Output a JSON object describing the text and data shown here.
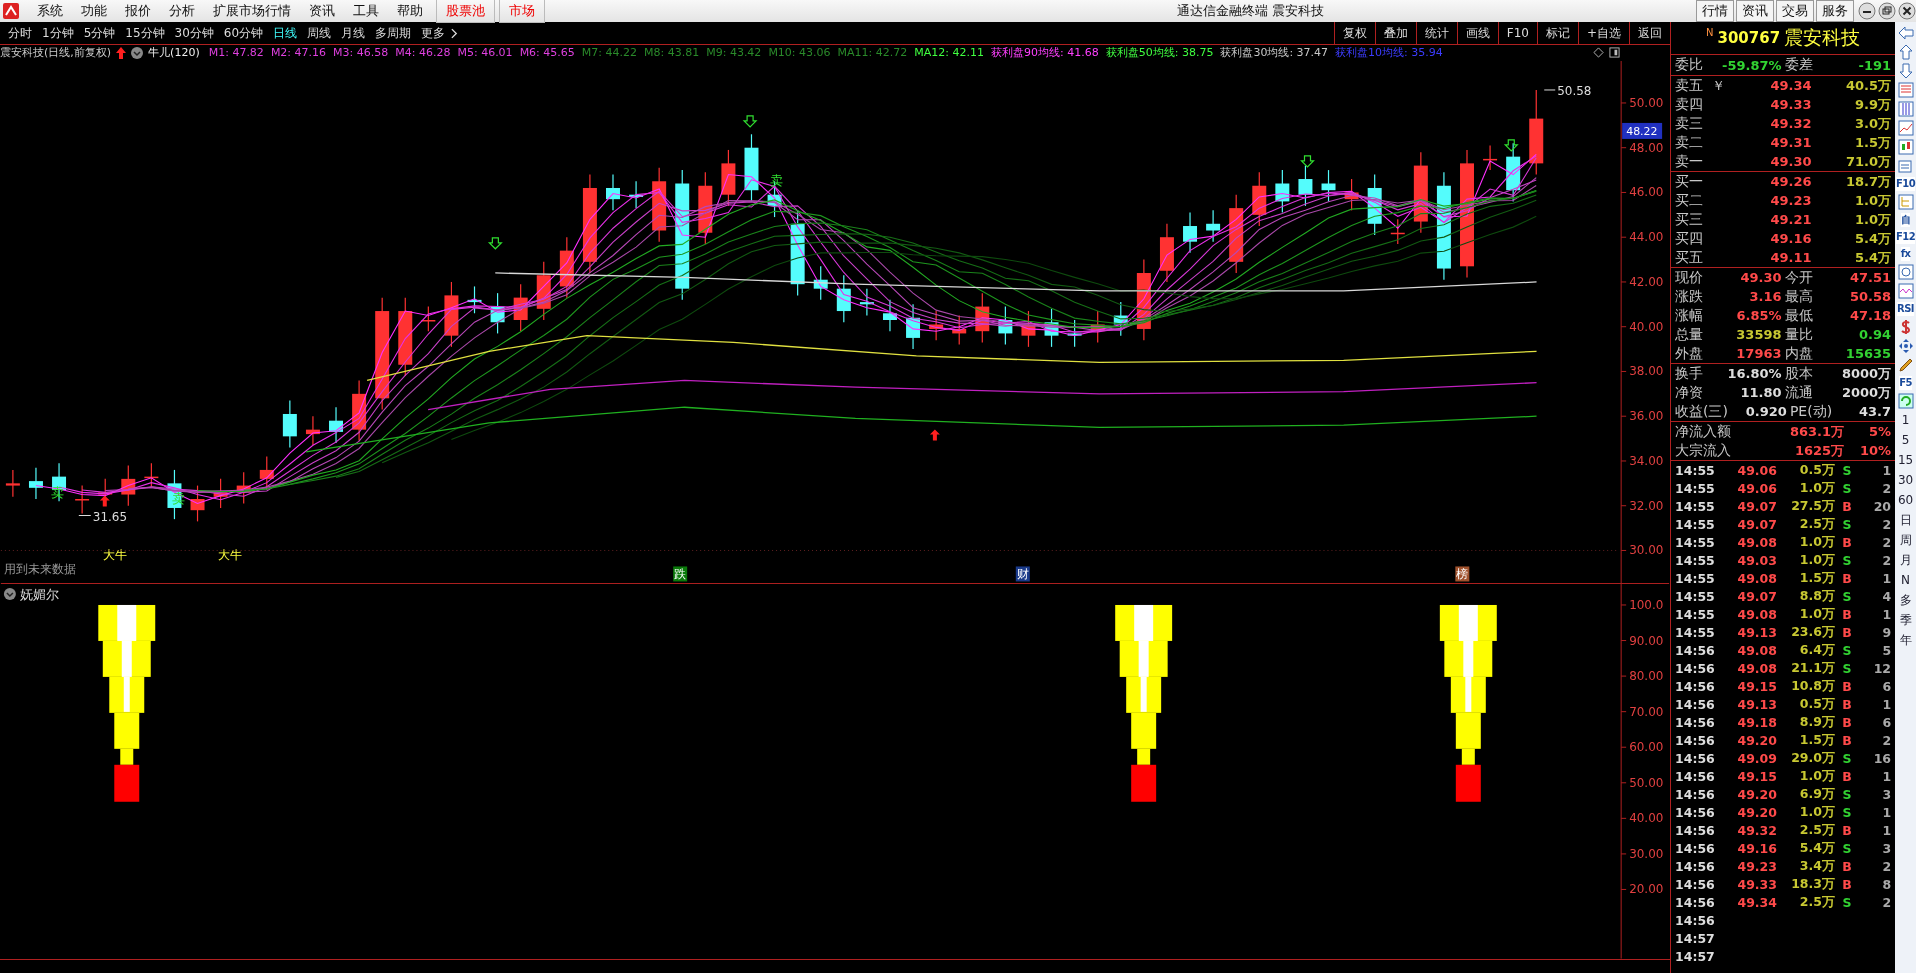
{
  "menu_bar": {
    "items": [
      {
        "label": "系统",
        "kind": "plain"
      },
      {
        "label": "功能",
        "kind": "plain"
      },
      {
        "label": "报价",
        "kind": "plain"
      },
      {
        "label": "分析",
        "kind": "plain"
      },
      {
        "label": "扩展市场行情",
        "kind": "plain"
      },
      {
        "label": "资讯",
        "kind": "plain"
      },
      {
        "label": "工具",
        "kind": "plain"
      },
      {
        "label": "帮助",
        "kind": "plain"
      },
      {
        "label": "股票池",
        "kind": "highlight"
      },
      {
        "label": "市场",
        "kind": "highlight"
      }
    ],
    "title": "通达信金融终端 震安科技",
    "buttons": [
      "行情",
      "资讯",
      "交易",
      "服务"
    ]
  },
  "period_tabs": [
    {
      "label": "分时",
      "selected": false
    },
    {
      "label": "1分钟",
      "selected": false
    },
    {
      "label": "5分钟",
      "selected": false
    },
    {
      "label": "15分钟",
      "selected": false
    },
    {
      "label": "30分钟",
      "selected": false
    },
    {
      "label": "60分钟",
      "selected": false
    },
    {
      "label": "日线",
      "selected": true
    },
    {
      "label": "周线",
      "selected": false
    },
    {
      "label": "月线",
      "selected": false
    },
    {
      "label": "多周期",
      "selected": false
    },
    {
      "label": "更多",
      "selected": false
    }
  ],
  "toolbar": [
    "复权",
    "叠加",
    "统计",
    "画线",
    "F10",
    "标记",
    "+自选",
    "返回"
  ],
  "indicator_header": {
    "stock": "震安科技(日线,前复权)",
    "formula": "牛儿(120)",
    "values": [
      {
        "text": "M1: 47.82",
        "color": "#e040e0"
      },
      {
        "text": "M2: 47.16",
        "color": "#e040e0"
      },
      {
        "text": "M3: 46.58",
        "color": "#e040e0"
      },
      {
        "text": "M4: 46.28",
        "color": "#e040e0"
      },
      {
        "text": "M5: 46.01",
        "color": "#e040e0"
      },
      {
        "text": "M6: 45.65",
        "color": "#e040e0"
      },
      {
        "text": "M7: 44.22",
        "color": "#2a8a2a"
      },
      {
        "text": "M8: 43.81",
        "color": "#2a8a2a"
      },
      {
        "text": "M9: 43.42",
        "color": "#2a8a2a"
      },
      {
        "text": "M10: 43.06",
        "color": "#2a8a2a"
      },
      {
        "text": "MA11: 42.72",
        "color": "#2a8a2a"
      },
      {
        "text": "MA12: 42.11",
        "color": "#40ff40"
      },
      {
        "text": "获利盘90均线: 41.68",
        "color": "#ff40ff"
      },
      {
        "text": "获利盘50均线: 38.75",
        "color": "#40ff40"
      },
      {
        "text": "获利盘30均线: 37.47",
        "color": "#c8c8c8"
      },
      {
        "text": "获利盘10均线: 35.94",
        "color": "#3c3cff"
      }
    ]
  },
  "main_chart": {
    "y_ticks": [
      "50.00",
      "48.00",
      "46.00",
      "44.00",
      "42.00",
      "40.00",
      "38.00",
      "36.00",
      "34.00",
      "32.00",
      "30.00"
    ],
    "last_price_tag": "48.22",
    "high_label": "50.58",
    "low_label": "31.65",
    "warning": "用到未来数据",
    "sell_marks": [
      "卖",
      "卖",
      "卖"
    ],
    "bull_marks": [
      "大牛",
      "大牛"
    ],
    "tags": [
      {
        "text": "跌",
        "color": "#0a7a0a"
      },
      {
        "text": "财",
        "color": "#1a3a8a"
      },
      {
        "text": "榜",
        "color": "#a0522d"
      }
    ]
  },
  "sub_chart": {
    "title": "妩媚尔",
    "y_ticks": [
      "100.0",
      "90.00",
      "80.00",
      "70.00",
      "60.00",
      "50.00",
      "40.00",
      "30.00",
      "20.00"
    ]
  },
  "quote_panel": {
    "badge": "N",
    "code": "300767",
    "name": "震安科技",
    "ratio": [
      {
        "label": "委比",
        "value": "-59.87%"
      },
      {
        "label": "委差",
        "value": "-191"
      }
    ],
    "asks": [
      {
        "label": "卖五",
        "note": "￥",
        "price": "49.34",
        "volume": "40.5万"
      },
      {
        "label": "卖四",
        "price": "49.33",
        "volume": "9.9万"
      },
      {
        "label": "卖三",
        "price": "49.32",
        "volume": "3.0万"
      },
      {
        "label": "卖二",
        "price": "49.31",
        "volume": "1.5万"
      },
      {
        "label": "卖一",
        "price": "49.30",
        "volume": "71.0万"
      }
    ],
    "bids": [
      {
        "label": "买一",
        "price": "49.26",
        "volume": "18.7万"
      },
      {
        "label": "买二",
        "price": "49.23",
        "volume": "1.0万"
      },
      {
        "label": "买三",
        "price": "49.21",
        "volume": "1.0万"
      },
      {
        "label": "买四",
        "price": "49.16",
        "volume": "5.4万"
      },
      {
        "label": "买五",
        "price": "49.11",
        "volume": "5.4万"
      }
    ],
    "quote": [
      [
        {
          "label": "现价",
          "value": "49.30",
          "color": "#ff4a4a"
        },
        {
          "label": "今开",
          "value": "47.51",
          "color": "#ff4a4a"
        }
      ],
      [
        {
          "label": "涨跌",
          "value": "3.16",
          "color": "#ff4a4a"
        },
        {
          "label": "最高",
          "value": "50.58",
          "color": "#ff4a4a"
        }
      ],
      [
        {
          "label": "涨幅",
          "value": "6.85%",
          "color": "#ff4a4a"
        },
        {
          "label": "最低",
          "value": "47.18",
          "color": "#ff4a4a"
        }
      ],
      [
        {
          "label": "总量",
          "value": "33598",
          "color": "#c8c832"
        },
        {
          "label": "量比",
          "value": "0.94",
          "color": "#32d232"
        }
      ],
      [
        {
          "label": "外盘",
          "value": "17963",
          "color": "#ff4a4a"
        },
        {
          "label": "内盘",
          "value": "15635",
          "color": "#32d232"
        }
      ]
    ],
    "fundamentals": [
      [
        {
          "label": "换手",
          "value": "16.80%"
        },
        {
          "label": "股本",
          "value": "8000万"
        }
      ],
      [
        {
          "label": "净资",
          "value": "11.80"
        },
        {
          "label": "流通",
          "value": "2000万"
        }
      ],
      [
        {
          "label": "收益(三)",
          "value": "0.920"
        },
        {
          "label": "PE(动)",
          "value": "43.7"
        }
      ]
    ],
    "flows": [
      {
        "label": "净流入额",
        "amount": "863.1万",
        "percent": "5%"
      },
      {
        "label": "大宗流入",
        "amount": "1625万",
        "percent": "10%"
      }
    ],
    "trades": [
      {
        "time": "14:55",
        "price": "49.06",
        "volume": "0.5万",
        "side": "S",
        "kind": "sell",
        "count": "1"
      },
      {
        "time": "14:55",
        "price": "49.06",
        "volume": "1.0万",
        "side": "S",
        "kind": "sell",
        "count": "2"
      },
      {
        "time": "14:55",
        "price": "49.07",
        "volume": "27.5万",
        "side": "B",
        "kind": "buy",
        "count": "20"
      },
      {
        "time": "14:55",
        "price": "49.07",
        "volume": "2.5万",
        "side": "S",
        "kind": "sell",
        "count": "2"
      },
      {
        "time": "14:55",
        "price": "49.08",
        "volume": "1.0万",
        "side": "B",
        "kind": "buy",
        "count": "2"
      },
      {
        "time": "14:55",
        "price": "49.03",
        "volume": "1.0万",
        "side": "S",
        "kind": "sell",
        "count": "2"
      },
      {
        "time": "14:55",
        "price": "49.08",
        "volume": "1.5万",
        "side": "B",
        "kind": "buy",
        "count": "1"
      },
      {
        "time": "14:55",
        "price": "49.07",
        "volume": "8.8万",
        "side": "S",
        "kind": "sell",
        "count": "4"
      },
      {
        "time": "14:55",
        "price": "49.08",
        "volume": "1.0万",
        "side": "B",
        "kind": "buy",
        "count": "1"
      },
      {
        "time": "14:55",
        "price": "49.13",
        "volume": "23.6万",
        "side": "B",
        "kind": "buy",
        "count": "9"
      },
      {
        "time": "14:56",
        "price": "49.08",
        "volume": "6.4万",
        "side": "S",
        "kind": "sell",
        "count": "5"
      },
      {
        "time": "14:56",
        "price": "49.08",
        "volume": "21.1万",
        "side": "S",
        "kind": "sell",
        "count": "12"
      },
      {
        "time": "14:56",
        "price": "49.15",
        "volume": "10.8万",
        "side": "B",
        "kind": "buy",
        "count": "6"
      },
      {
        "time": "14:56",
        "price": "49.13",
        "volume": "0.5万",
        "side": "B",
        "kind": "buy",
        "count": "1"
      },
      {
        "time": "14:56",
        "price": "49.18",
        "volume": "8.9万",
        "side": "B",
        "kind": "buy",
        "count": "6"
      },
      {
        "time": "14:56",
        "price": "49.20",
        "volume": "1.5万",
        "side": "B",
        "kind": "buy",
        "count": "2"
      },
      {
        "time": "14:56",
        "price": "49.09",
        "volume": "29.0万",
        "side": "S",
        "kind": "sell",
        "count": "16"
      },
      {
        "time": "14:56",
        "price": "49.15",
        "volume": "1.0万",
        "side": "B",
        "kind": "buy",
        "count": "1"
      },
      {
        "time": "14:56",
        "price": "49.20",
        "volume": "6.9万",
        "side": "S",
        "kind": "sell",
        "count": "3"
      },
      {
        "time": "14:56",
        "price": "49.20",
        "volume": "1.0万",
        "side": "S",
        "kind": "sell",
        "count": "1"
      },
      {
        "time": "14:56",
        "price": "49.32",
        "volume": "2.5万",
        "side": "B",
        "kind": "buy",
        "count": "1"
      },
      {
        "time": "14:56",
        "price": "49.16",
        "volume": "5.4万",
        "side": "S",
        "kind": "sell",
        "count": "3"
      },
      {
        "time": "14:56",
        "price": "49.23",
        "volume": "3.4万",
        "side": "B",
        "kind": "buy",
        "count": "2"
      },
      {
        "time": "14:56",
        "price": "49.33",
        "volume": "18.3万",
        "side": "B",
        "kind": "buy",
        "count": "8"
      },
      {
        "time": "14:56",
        "price": "49.34",
        "volume": "2.5万",
        "side": "S",
        "kind": "sell",
        "count": "2"
      },
      {
        "time": "14:56"
      },
      {
        "time": "14:57"
      },
      {
        "time": "14:57"
      }
    ]
  },
  "side_strip": {
    "tools": [
      {
        "kind": "arrow-left"
      },
      {
        "kind": "arrow-up"
      },
      {
        "kind": "arrow-down"
      },
      {
        "kind": "table"
      },
      {
        "kind": "grid"
      },
      {
        "kind": "line-chart"
      },
      {
        "kind": "candles"
      },
      {
        "kind": "window"
      },
      {
        "kind": "text",
        "label": "F10"
      },
      {
        "kind": "tree"
      },
      {
        "kind": "text",
        "label": "自"
      },
      {
        "kind": "text",
        "label": "F12"
      },
      {
        "kind": "text",
        "label": "fx"
      },
      {
        "kind": "circle"
      },
      {
        "kind": "wave"
      },
      {
        "kind": "text",
        "label": "RSI"
      },
      {
        "kind": "dollar"
      },
      {
        "kind": "move"
      },
      {
        "kind": "pencil"
      },
      {
        "kind": "text",
        "label": "F5"
      },
      {
        "kind": "refresh"
      }
    ],
    "periods": [
      "1",
      "5",
      "15",
      "30",
      "60",
      "日",
      "周",
      "月",
      "N",
      "多",
      "季",
      "年"
    ]
  }
}
